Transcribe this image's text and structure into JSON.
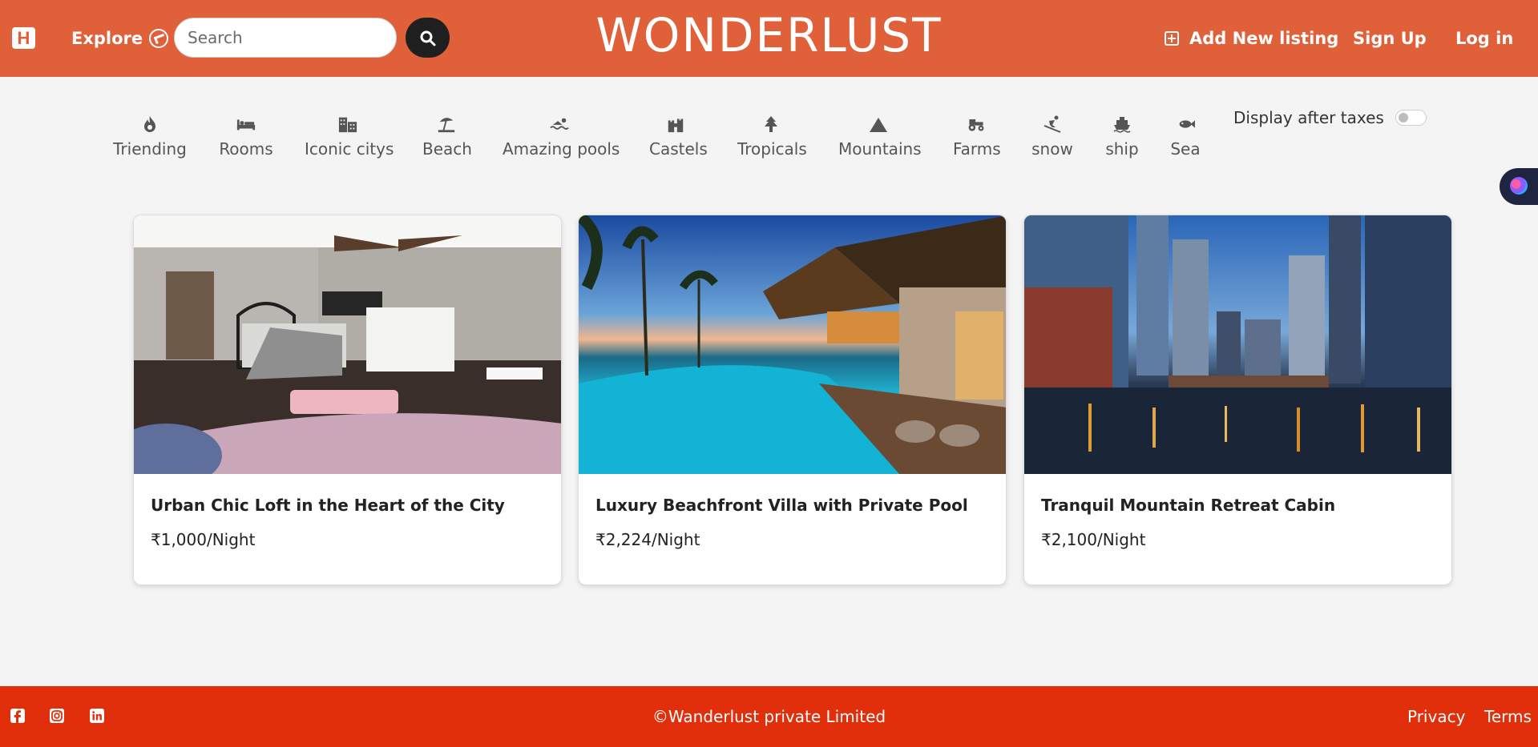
{
  "navbar": {
    "logo_letter": "H",
    "explore_label": "Explore",
    "search_placeholder": "Search",
    "brand": "WONDERLUST",
    "add_listing_label": "Add New listing",
    "signup_label": "Sign Up",
    "login_label": "Log in"
  },
  "filters": [
    {
      "label": "Triending",
      "icon": "fire-icon"
    },
    {
      "label": "Rooms",
      "icon": "bed-icon"
    },
    {
      "label": "Iconic citys",
      "icon": "city-icon"
    },
    {
      "label": "Beach",
      "icon": "umbrella-beach-icon"
    },
    {
      "label": "Amazing pools",
      "icon": "swimmer-icon"
    },
    {
      "label": "Castels",
      "icon": "castle-icon"
    },
    {
      "label": "Tropicals",
      "icon": "tree-icon"
    },
    {
      "label": "Mountains",
      "icon": "mountain-icon"
    },
    {
      "label": "Farms",
      "icon": "tractor-icon"
    },
    {
      "label": "snow",
      "icon": "skier-icon"
    },
    {
      "label": "ship",
      "icon": "ship-icon"
    },
    {
      "label": "Sea",
      "icon": "fish-icon"
    }
  ],
  "tax_toggle": {
    "label": "Display after taxes",
    "enabled": false
  },
  "listings": [
    {
      "title": "Urban Chic Loft in the Heart of the City",
      "price": "₹1,000/Night"
    },
    {
      "title": "Luxury Beachfront Villa with Private Pool",
      "price": "₹2,224/Night"
    },
    {
      "title": "Tranquil Mountain Retreat Cabin",
      "price": "₹2,100/Night"
    }
  ],
  "footer": {
    "copyright": "©Wanderlust private Limited",
    "privacy_label": "Privacy",
    "terms_label": "Terms",
    "social_icons": [
      "facebook-icon",
      "instagram-icon",
      "linkedin-icon"
    ]
  },
  "colors": {
    "navbar": "#e0603a",
    "footer": "#e12f0b",
    "search_button": "#1f1f1f"
  }
}
